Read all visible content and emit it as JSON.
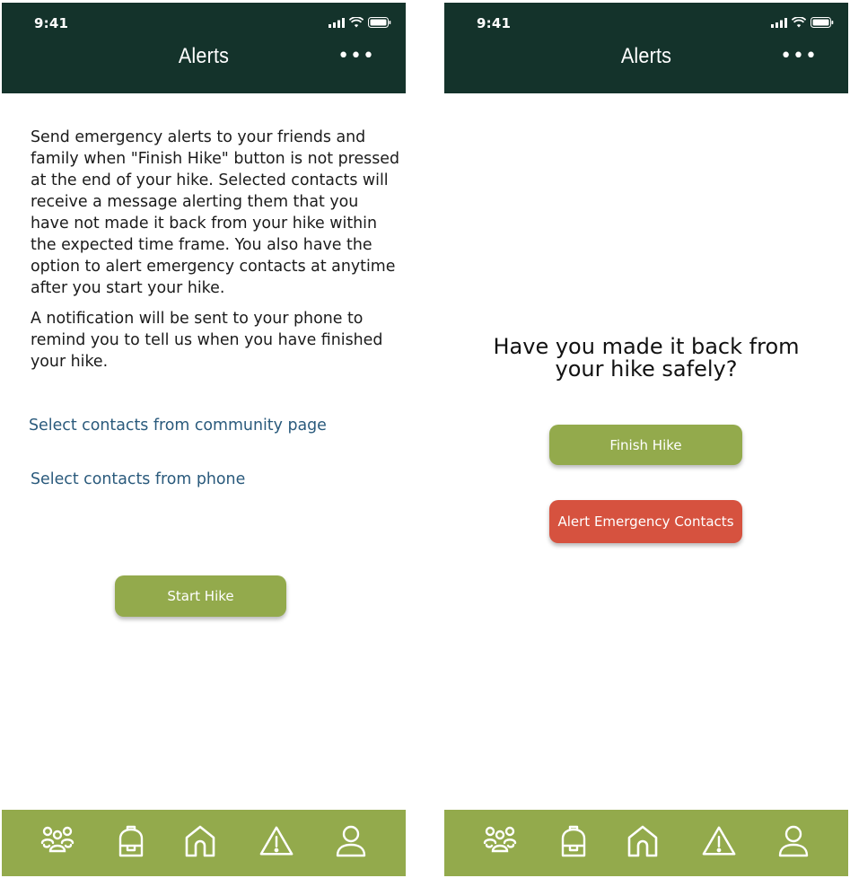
{
  "status_bar": {
    "time": "9:41"
  },
  "header": {
    "title": "Alerts",
    "more_label": "•••"
  },
  "left_screen": {
    "intro_paragraphs": [
      "Send emergency alerts to your friends and family when \"Finish Hike\" button is not pressed at the end of your hike. Selected contacts will receive a message alerting them that you have not made it back from your hike within the expected time frame. You also have the option to alert emergency contacts at anytime after you start your hike.",
      "A notification will be sent to your phone to remind you to tell us when you have finished your hike."
    ],
    "link_community": "Select contacts from community page",
    "link_phone": "Select contacts from phone",
    "start_button": "Start Hike"
  },
  "right_screen": {
    "question_line1": "Have you made it back from",
    "question_line2": "your hike safely?",
    "finish_button": "Finish Hike",
    "alert_button": "Alert Emergency Contacts"
  },
  "tabbar": {
    "items": [
      {
        "icon": "community-icon"
      },
      {
        "icon": "backpack-icon"
      },
      {
        "icon": "home-icon"
      },
      {
        "icon": "alert-icon"
      },
      {
        "icon": "profile-icon"
      }
    ]
  },
  "colors": {
    "header_bg": "#14332b",
    "accent_green": "#93aa4c",
    "alert_red": "#d6523f",
    "link_blue": "#2a5a7c"
  }
}
